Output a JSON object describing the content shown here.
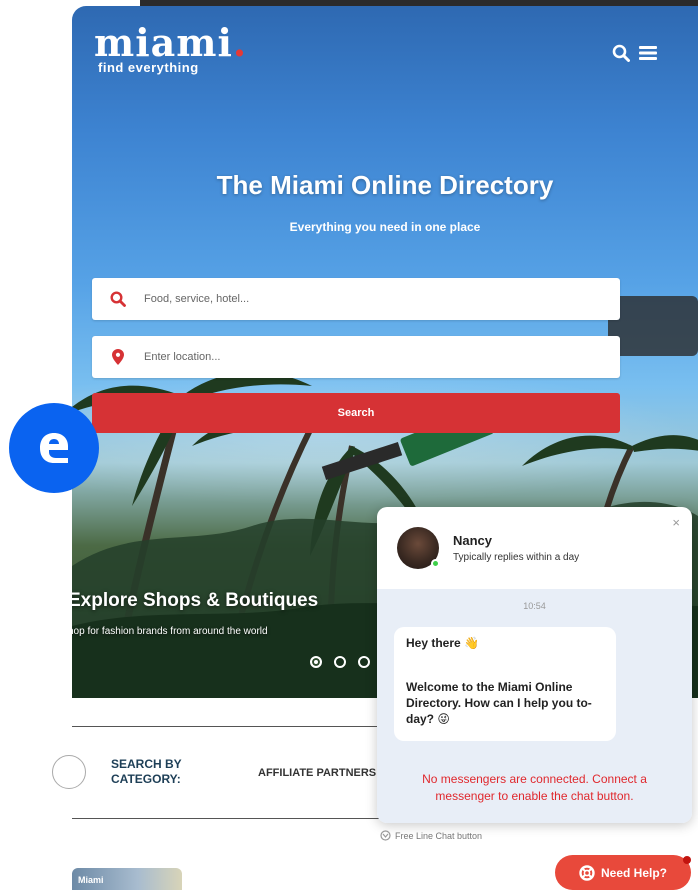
{
  "logo": {
    "word": "miami",
    "dot": ".",
    "tagline": "find everything"
  },
  "header": {
    "search_icon": "search-icon",
    "menu_icon": "hamburger-menu-icon"
  },
  "hero": {
    "title": "The Miami Online Directory",
    "subtitle": "Everything you need in one place",
    "search": {
      "what_placeholder": "Food, service, hotel...",
      "where_placeholder": "Enter location...",
      "button_label": "Search"
    },
    "slide": {
      "title": "Explore Shops & Boutiques",
      "subtitle": "hop for fashion brands from around the world",
      "dot_count": 3,
      "active_dot": 1
    }
  },
  "badge": {
    "letter_icon": "e-logo-icon"
  },
  "categories": {
    "label_line1": "SEARCH BY",
    "label_line2": "CATEGORY:",
    "affiliate": "AFFILIATE PARTNERS"
  },
  "thumbnail": {
    "label": "Miami"
  },
  "chat": {
    "close": "×",
    "agent_name": "Nancy",
    "agent_status": "Typically replies within a day",
    "time": "10:54",
    "message_line1": "Hey there 👋",
    "message_line2": "Welcome to the Miami Online Directory. How can I help you to-day? 😜",
    "warning": "No messengers are connected. Connect a messenger to enable the chat button.",
    "powered_by": "Free Line Chat button"
  },
  "help_button": {
    "label": "Need Help?"
  },
  "colors": {
    "brand_red": "#d63235",
    "badge_blue": "#0a63f0",
    "help_orange": "#e8493b",
    "online_green": "#3ecf4a"
  }
}
